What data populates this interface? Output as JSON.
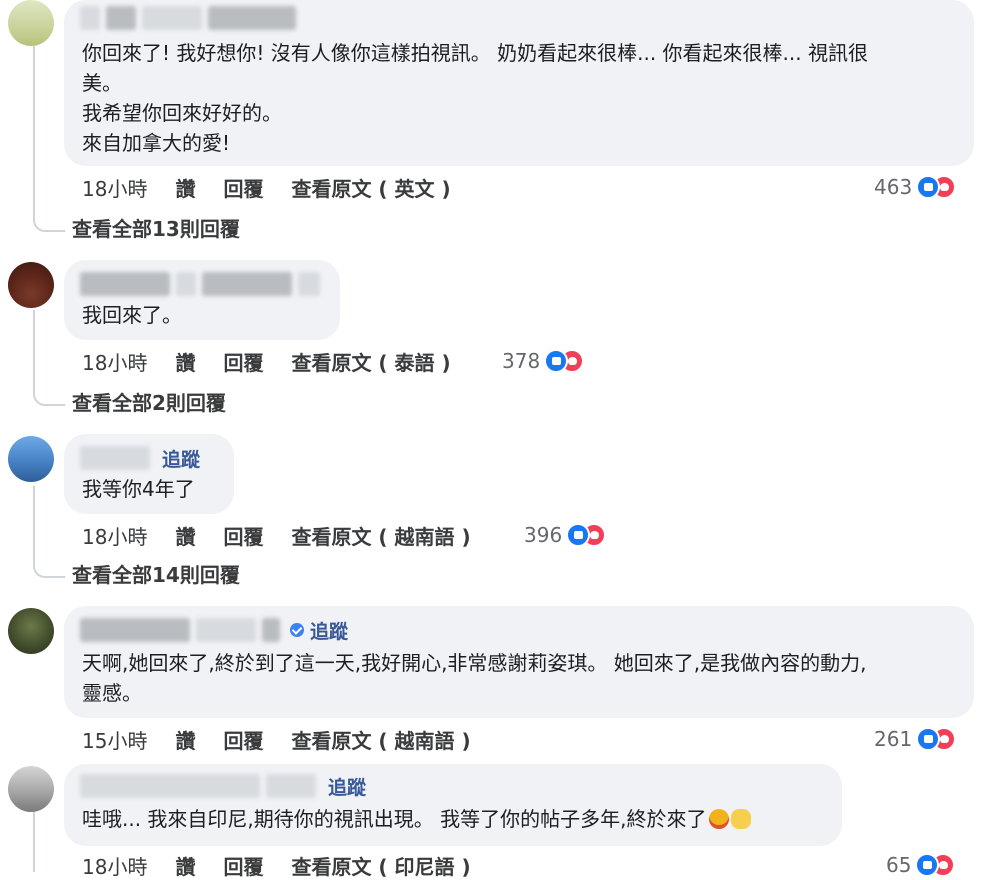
{
  "comments": [
    {
      "text": "你回來了! 我好想你! 沒有人像你這樣拍視訊。 奶奶看起來很棒... 你看起來很棒... 視訊很\n美。\n我希望你回來好好的。\n來自加拿大的愛!",
      "time": "18小時",
      "like": "讚",
      "reply": "回覆",
      "see_original": "查看原文 ( 英文 )",
      "reactions": "463",
      "view_replies": "查看全部13則回覆"
    },
    {
      "text": "我回來了。",
      "time": "18小時",
      "like": "讚",
      "reply": "回覆",
      "see_original": "查看原文 ( 泰語 )",
      "reactions": "378",
      "view_replies": "查看全部2則回覆"
    },
    {
      "follow": "追蹤",
      "text": "我等你4年了",
      "time": "18小時",
      "like": "讚",
      "reply": "回覆",
      "see_original": "查看原文 ( 越南語 )",
      "reactions": "396",
      "view_replies": "查看全部14則回覆"
    },
    {
      "follow": "追蹤",
      "text": "天啊,她回來了,終於到了這一天,我好開心,非常感謝莉姿琪。 她回來了,是我做內容的動力,\n靈感。",
      "time": "15小時",
      "like": "讚",
      "reply": "回覆",
      "see_original": "查看原文 ( 越南語 )",
      "reactions": "261"
    },
    {
      "follow": "追蹤",
      "text": "哇哦... 我來自印尼,期待你的視訊出現。 我等了你的帖子多年,終於來了",
      "time": "18小時",
      "like": "讚",
      "reply": "回覆",
      "see_original": "查看原文 ( 印尼語 )",
      "reactions": "65"
    }
  ],
  "colors": {
    "bubble": "#f0f2f5",
    "like": "#1877f2",
    "love": "#f33e58",
    "follow": "#385898"
  }
}
